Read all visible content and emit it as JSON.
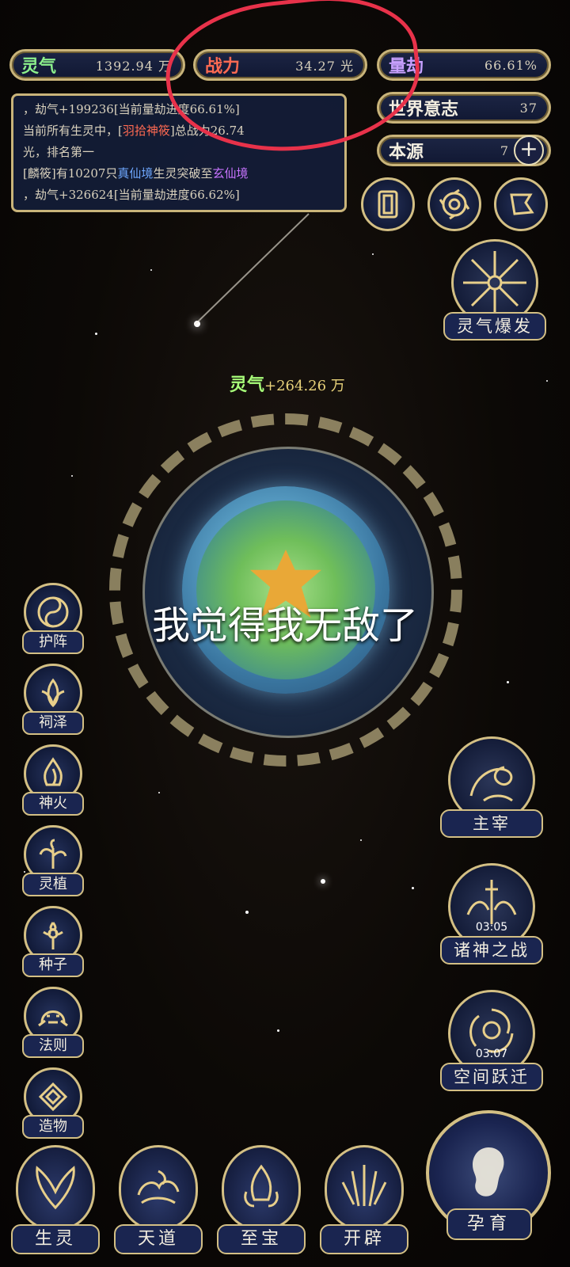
{
  "stats": {
    "lingqi": {
      "label": "灵气",
      "value": "1392.94 万"
    },
    "zhanli": {
      "label": "战力",
      "value": "34.27 光"
    },
    "liangjie": {
      "label": "量劫",
      "value": "66.61%"
    },
    "shijie": {
      "label": "世界意志",
      "value": "37"
    },
    "benyuan": {
      "label": "本源",
      "value": "7",
      "plus": "+"
    }
  },
  "log": {
    "line1": "，劫气+199236[当前量劫进度66.61%]",
    "line2a": "当前所有生灵中，[",
    "line2b": "羽拾神筱",
    "line2c": "]总战力26.74",
    "line3": "光，排名第一",
    "line4a": "[麟筱]有10207只",
    "line4b": "真仙境",
    "line4c": "生灵突破至",
    "line4d": "玄仙境",
    "line5": "，劫气+326624[当前量劫进度66.62%]"
  },
  "float": {
    "label": "灵气",
    "amount": "+264.26 万"
  },
  "overlay_caption": "我觉得我无敌了",
  "burst": {
    "label": "灵气爆发"
  },
  "left_buttons": [
    "护阵",
    "祠泽",
    "神火",
    "灵植",
    "种子",
    "法则",
    "造物"
  ],
  "right_buttons": {
    "zhuzai": "主宰",
    "zhushen": {
      "label": "诸神之战",
      "timer": "03:05"
    },
    "kongjian": {
      "label": "空间跃迁",
      "timer": "03:07"
    }
  },
  "bottom_buttons": [
    "生灵",
    "天道",
    "至宝",
    "开辟"
  ],
  "yunyu": {
    "label": "孕育"
  },
  "colors": {
    "gold": "#d3bf84",
    "panel": "#1a2550",
    "annotation": "#e8324a"
  }
}
